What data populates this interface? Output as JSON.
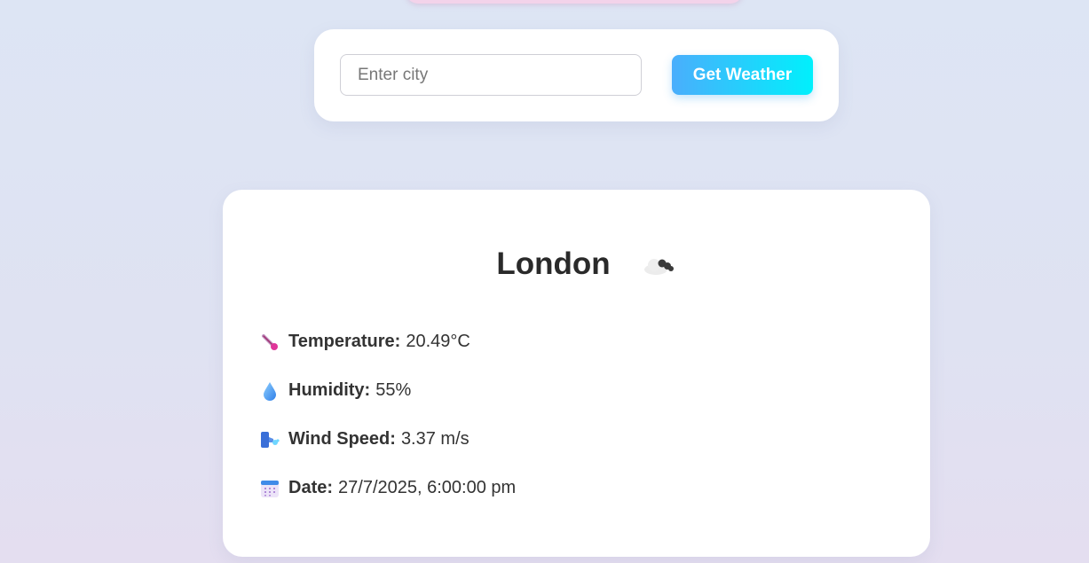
{
  "search": {
    "placeholder": "Enter city",
    "value": "",
    "button_label": "Get Weather"
  },
  "weather": {
    "city": "London",
    "condition_icon": "cloud-icon",
    "rows": [
      {
        "icon": "thermometer-icon",
        "label": "Temperature:",
        "value": "20.49°C"
      },
      {
        "icon": "droplet-icon",
        "label": "Humidity:",
        "value": "55%"
      },
      {
        "icon": "wind-icon",
        "label": "Wind Speed:",
        "value": "3.37 m/s"
      },
      {
        "icon": "calendar-icon",
        "label": "Date:",
        "value": "27/7/2025, 6:00:00 pm"
      }
    ]
  },
  "colors": {
    "button_gradient_start": "#4aaefc",
    "button_gradient_end": "#00f0fc"
  }
}
